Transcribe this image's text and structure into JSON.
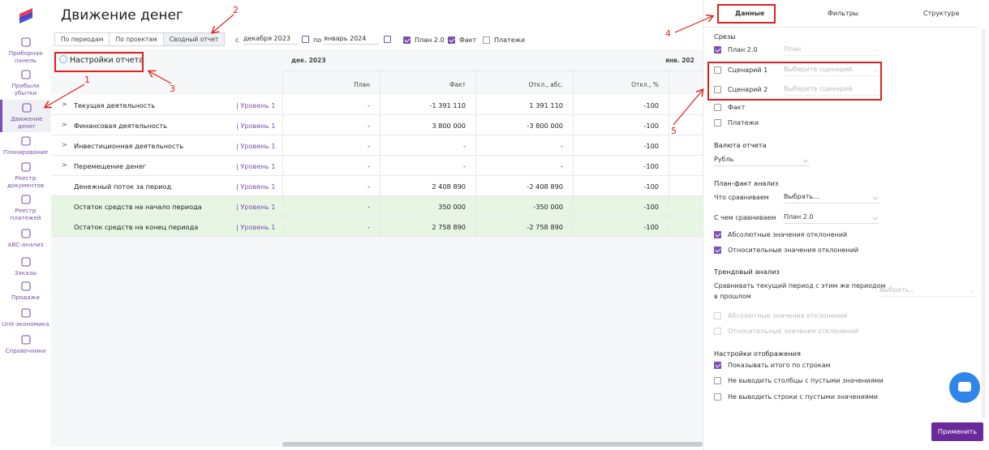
{
  "sidebar": {
    "items": [
      {
        "label": "Приборная панель",
        "icon": "dashboard-icon"
      },
      {
        "label": "Прибыли убытки",
        "icon": "chart-icon"
      },
      {
        "label": "Движение денег",
        "icon": "coins-icon",
        "active": true
      },
      {
        "label": "Планирование",
        "icon": "target-icon"
      },
      {
        "label": "Реестр документов",
        "icon": "documents-icon"
      },
      {
        "label": "Реестр платежей",
        "icon": "payments-icon"
      },
      {
        "label": "ABC-анализ",
        "icon": "abc-icon"
      },
      {
        "label": "Заказы",
        "icon": "orders-icon"
      },
      {
        "label": "Продажи",
        "icon": "dollar-icon"
      },
      {
        "label": "Unit-экономика",
        "icon": "unit-icon"
      },
      {
        "label": "Справочники",
        "icon": "folder-icon"
      }
    ]
  },
  "header": {
    "title": "Движение денег",
    "tabs": [
      "По периодам",
      "По проектам",
      "Сводный отчет"
    ],
    "from_label": "с",
    "from_value": "декабря 2023",
    "to_label": "по",
    "to_value": "январь 2024",
    "filters": [
      {
        "label": "План 2.0",
        "checked": true
      },
      {
        "label": "Факт",
        "checked": true
      },
      {
        "label": "Платежи",
        "checked": false
      }
    ]
  },
  "report": {
    "settings_label": "Настройки отчета",
    "months": [
      "дек. 2023",
      "янв. 202"
    ],
    "columns": [
      "План",
      "Факт",
      "Откл., абс.",
      "Откл., %"
    ],
    "rows": [
      {
        "name": "Текущая деятельность",
        "level": "| Уровень 1",
        "expand": true,
        "plan": "-",
        "fact": "-1 391 110",
        "abs": "1 391 110",
        "pct": "-100",
        "highlight": false
      },
      {
        "name": "Финансовая деятельность",
        "level": "| Уровень 1",
        "expand": true,
        "plan": "-",
        "fact": "3 800 000",
        "abs": "-3 800 000",
        "pct": "-100",
        "highlight": false
      },
      {
        "name": "Инвестиционная деятельность",
        "level": "| Уровень 1",
        "expand": true,
        "plan": "-",
        "fact": "-",
        "abs": "-",
        "pct": "-100",
        "highlight": false
      },
      {
        "name": "Перемещение денег",
        "level": "| Уровень 1",
        "expand": true,
        "plan": "-",
        "fact": "-",
        "abs": "-",
        "pct": "-100",
        "highlight": false
      },
      {
        "name": "Денежный поток за период",
        "level": "| Уровень 1",
        "expand": false,
        "plan": "-",
        "fact": "2 408 890",
        "abs": "-2 408 890",
        "pct": "-100",
        "highlight": false
      },
      {
        "name": "Остаток средств на начало периода",
        "level": "| Уровень 1",
        "expand": false,
        "plan": "-",
        "fact": "350 000",
        "abs": "-350 000",
        "pct": "-100",
        "highlight": true
      },
      {
        "name": "Остаток средств на конец периода",
        "level": "| Уровень 1",
        "expand": false,
        "plan": "-",
        "fact": "2 758 890",
        "abs": "-2 758 890",
        "pct": "-100",
        "highlight": true
      }
    ]
  },
  "panel": {
    "tabs": [
      "Данные",
      "Фильтры",
      "Структура"
    ],
    "slices_title": "Срезы",
    "plan_label": "План 2.0",
    "plan_select": "План",
    "scenario1_label": "Сценарий 1",
    "scenario2_label": "Сценарий 2",
    "scenario_placeholder": "Выберите сценарий",
    "fact_label": "Факт",
    "payments_label": "Платежи",
    "currency_title": "Валюта отчета",
    "currency_value": "Рубль",
    "planfact_title": "План-факт анализ",
    "compare_what_label": "Что сравниваем",
    "compare_what_value": "Выбрать...",
    "compare_with_label": "С чем сравниваем",
    "compare_with_value": "План 2.0",
    "abs_dev": "Абсолютные значения отклонений",
    "rel_dev": "Относительные значения отклонений",
    "trend_title": "Трендовый анализ",
    "trend_text_1": "Сравнивать текущий период с этим же периодом",
    "trend_text_2": "в прошлом",
    "trend_select": "Выбрать...",
    "display_title": "Настройки отображения",
    "show_totals": "Показывать итого по строкам",
    "hide_empty_cols": "Не выводить столбцы с пустыми значениями",
    "hide_empty_rows": "Не выводить строки с пустыми значениями",
    "apply_label": "Применить"
  },
  "annotations": [
    "1",
    "2",
    "3",
    "4",
    "5"
  ],
  "colors": {
    "accent": "#7b4fb3",
    "annotation": "#e02020",
    "highlight_row": "#e7f5e3",
    "apply": "#6a2a9a",
    "chat": "#2f86e8"
  }
}
